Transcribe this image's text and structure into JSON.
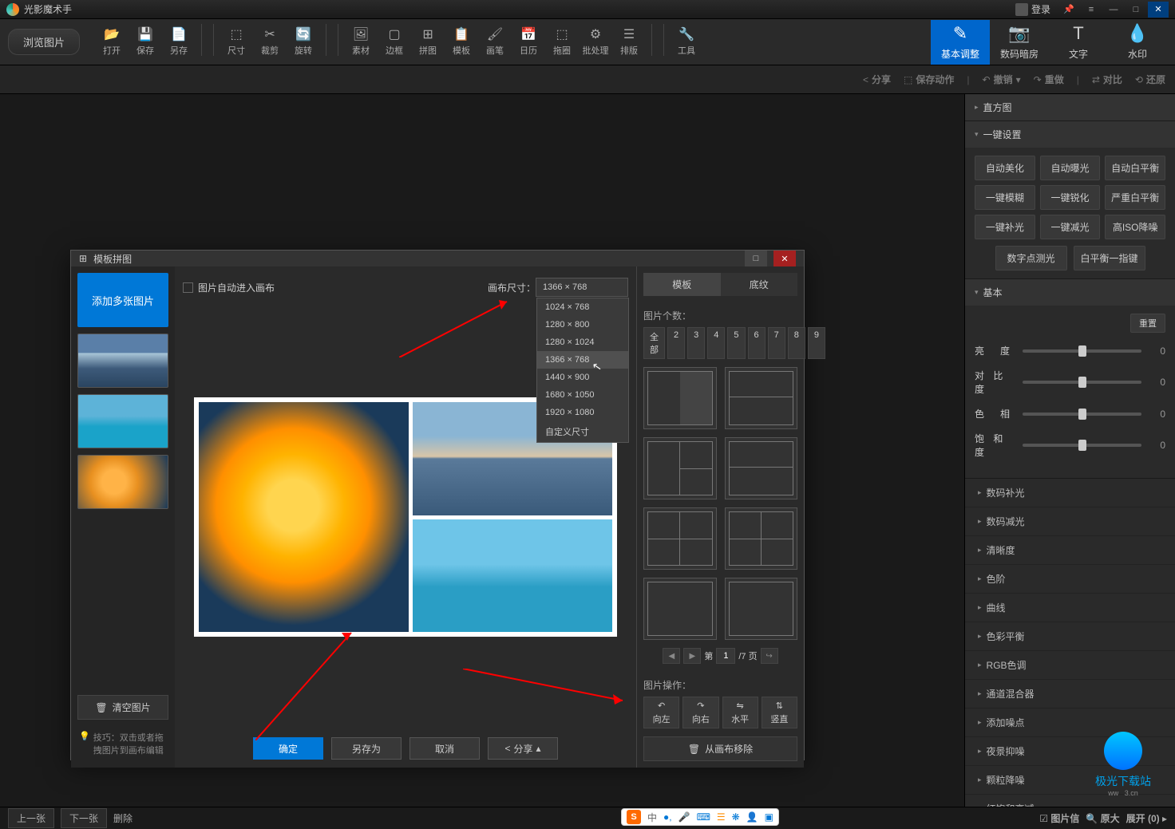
{
  "app": {
    "title": "光影魔术手",
    "login": "登录"
  },
  "toolbar": {
    "browse": "浏览图片",
    "items": [
      "打开",
      "保存",
      "另存",
      "尺寸",
      "裁剪",
      "旋转",
      "素材",
      "边框",
      "拼图",
      "模板",
      "画笔",
      "日历",
      "拖圈",
      "批处理",
      "排版",
      "工具"
    ],
    "rightTabs": [
      "基本调整",
      "数码暗房",
      "文字",
      "水印"
    ]
  },
  "actionbar": {
    "share": "分享",
    "saveAct": "保存动作",
    "undo": "撤销",
    "redo": "重做",
    "compare": "对比",
    "restore": "还原"
  },
  "rightPanel": {
    "histogram": "直方图",
    "oneKey": {
      "title": "一键设置",
      "btns": [
        "自动美化",
        "自动曝光",
        "自动白平衡",
        "一键模糊",
        "一键锐化",
        "严重白平衡",
        "一键补光",
        "一键减光",
        "高ISO降噪"
      ],
      "btns2": [
        "数字点测光",
        "白平衡一指键"
      ]
    },
    "basic": {
      "title": "基本",
      "reset": "重置",
      "sliders": [
        {
          "label": "亮　度",
          "value": "0"
        },
        {
          "label": "对 比 度",
          "value": "0"
        },
        {
          "label": "色　相",
          "value": "0"
        },
        {
          "label": "饱 和 度",
          "value": "0"
        }
      ]
    },
    "collapse": [
      "数码补光",
      "数码减光",
      "清晰度",
      "色阶",
      "曲线",
      "色彩平衡",
      "RGB色调",
      "通道混合器",
      "添加噪点",
      "夜景抑噪",
      "颗粒降噪",
      "红饱和衰减"
    ]
  },
  "modal": {
    "title": "模板拼图",
    "addImages": "添加多张图片",
    "clearImages": "清空图片",
    "tip": "技巧：双击或者拖拽图片到画布编辑",
    "autoFit": "图片自动进入画布",
    "canvasSize": "画布尺寸：",
    "sizeCurrent": "1366 × 768",
    "sizes": [
      "1024 × 768",
      "1280 × 800",
      "1280 × 1024",
      "1366 × 768",
      "1440 × 900",
      "1680 × 1050",
      "1920 × 1080",
      "自定义尺寸"
    ],
    "ok": "确定",
    "saveAs": "另存为",
    "cancel": "取消",
    "share": "分享",
    "tabs": {
      "template": "模板",
      "texture": "底纹"
    },
    "countLabel": "图片个数：",
    "counts": [
      "全部",
      "2",
      "3",
      "4",
      "5",
      "6",
      "7",
      "8",
      "9"
    ],
    "page": {
      "prefix": "第",
      "current": "1",
      "total": "/7 页"
    },
    "opsLabel": "图片操作：",
    "ops": [
      "向左",
      "向右",
      "水平",
      "竖直"
    ],
    "removeFromCanvas": "从画布移除"
  },
  "statusbar": {
    "prev": "上一张",
    "next": "下一张",
    "del": "删除",
    "info": "图片信",
    "orig": "原大",
    "expand": "展开 (0)"
  },
  "ime": {
    "zh": "中",
    "items": [
      "●",
      "✦",
      "⌨",
      "☰",
      "❋",
      "人",
      "▣"
    ]
  },
  "watermark": "极光下载站"
}
